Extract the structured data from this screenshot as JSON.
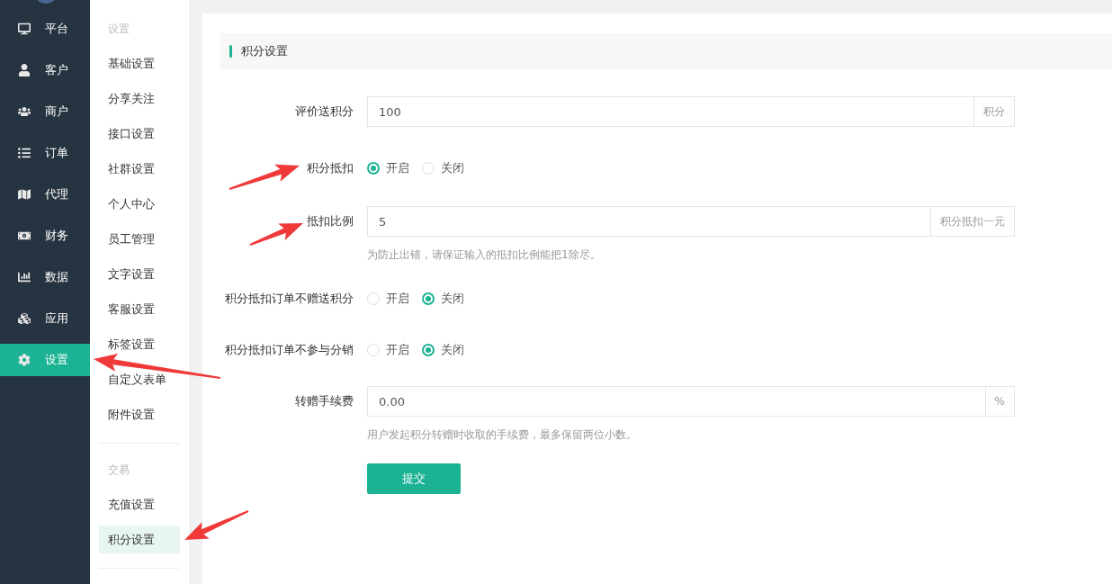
{
  "sidebar": {
    "items": [
      {
        "label": "平台",
        "selected": false
      },
      {
        "label": "客户",
        "selected": false
      },
      {
        "label": "商户",
        "selected": false
      },
      {
        "label": "订单",
        "selected": false
      },
      {
        "label": "代理",
        "selected": false
      },
      {
        "label": "财务",
        "selected": false
      },
      {
        "label": "数据",
        "selected": false
      },
      {
        "label": "应用",
        "selected": false
      },
      {
        "label": "设置",
        "selected": true
      }
    ]
  },
  "subnav": {
    "groups": [
      {
        "title": "设置",
        "items": [
          {
            "label": "基础设置",
            "selected": false
          },
          {
            "label": "分享关注",
            "selected": false
          },
          {
            "label": "接口设置",
            "selected": false
          },
          {
            "label": "社群设置",
            "selected": false
          },
          {
            "label": "个人中心",
            "selected": false
          },
          {
            "label": "员工管理",
            "selected": false
          },
          {
            "label": "文字设置",
            "selected": false
          },
          {
            "label": "客服设置",
            "selected": false
          },
          {
            "label": "标签设置",
            "selected": false
          },
          {
            "label": "自定义表单",
            "selected": false
          },
          {
            "label": "附件设置",
            "selected": false
          }
        ]
      },
      {
        "title": "交易",
        "items": [
          {
            "label": "充值设置",
            "selected": false
          },
          {
            "label": "积分设置",
            "selected": true
          }
        ]
      }
    ]
  },
  "panel": {
    "title": "积分设置",
    "rows": [
      {
        "kind": "input",
        "label": "评价送积分",
        "value": "100",
        "suffix": "积分"
      },
      {
        "kind": "radio",
        "label": "积分抵扣",
        "options": [
          {
            "label": "开启",
            "selected": true
          },
          {
            "label": "关闭",
            "selected": false
          }
        ]
      },
      {
        "kind": "input",
        "label": "抵扣比例",
        "value": "5",
        "suffix": "积分抵扣一元",
        "hint": "为防止出错，请保证输入的抵扣比例能把1除尽。"
      },
      {
        "kind": "radio",
        "label": "积分抵扣订单不赠送积分",
        "options": [
          {
            "label": "开启",
            "selected": false
          },
          {
            "label": "关闭",
            "selected": true
          }
        ]
      },
      {
        "kind": "radio",
        "label": "积分抵扣订单不参与分销",
        "options": [
          {
            "label": "开启",
            "selected": false
          },
          {
            "label": "关闭",
            "selected": true
          }
        ]
      },
      {
        "kind": "input",
        "label": "转赠手续费",
        "value": "0.00",
        "suffix": "%",
        "hint": "用户发起积分转赠时收取的手续费，最多保留两位小数。"
      }
    ],
    "submit": "提交"
  }
}
